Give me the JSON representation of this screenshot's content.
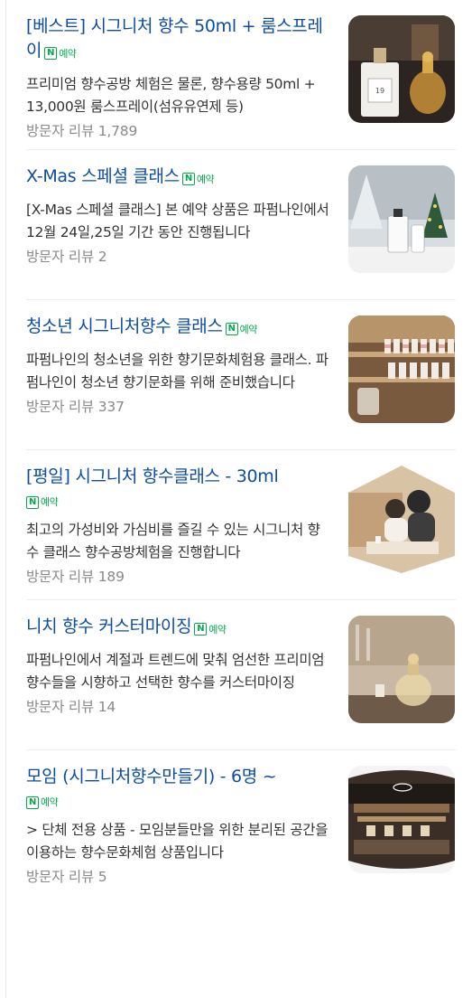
{
  "badge": {
    "icon": "N",
    "label": "예약"
  },
  "colors": {
    "title": "#0c4da2",
    "badge": "#03a94d",
    "desc": "#333333",
    "meta": "#8a8a8a"
  },
  "items": [
    {
      "title": "[베스트] 시그니처 향수 50ml + 룸스프레이",
      "desc": "프리미엄 향수공방 체험은 물론, 향수용량 50ml + 13,000원 룸스프레이(섬유유연제 등)",
      "reviews": "방문자 리뷰 1,789",
      "image": "perfume-bottles-on-shelf"
    },
    {
      "title": "X-Mas 스페셜 클래스",
      "desc": "[X-Mas 스페셜 클래스] 본 예약 상품은 파펌나인에서 12월 24일,25일 기간 동안 진행됩니다",
      "reviews": "방문자 리뷰 2",
      "image": "christmas-perfume-display"
    },
    {
      "title": "청소년 시그니처향수 클래스",
      "desc": "파펌나인의 청소년을 위한 향기문화체험용 클래스. 파펌나인이 청소년 향기문화를 위해 준비했습니다",
      "reviews": "방문자 리뷰 337",
      "image": "fragrance-bottle-rack"
    },
    {
      "title": "[평일] 시그니처 향수클래스 - 30ml",
      "desc": "최고의 가성비와 가심비를 즐길 수 있는 시그니처 향수 클래스 향수공방체험을 진행합니다",
      "reviews": "방문자 리뷰 189",
      "image": "people-making-perfume"
    },
    {
      "title": "니치 향수 커스터마이징",
      "desc": "파펌나인에서 계절과 트렌드에 맞춰 엄선한 프리미엄 향수들을 시향하고 선택한 향수를 커스터마이징",
      "reviews": "방문자 리뷰 14",
      "image": "glass-perfume-bottle"
    },
    {
      "title": "모임 (시그니처향수만들기) - 6명 ~",
      "desc": "> 단체 전용 상품 - 모임분들만을 위한 분리된 공간을 이용하는 향수문화체험 상품입니다",
      "reviews": "방문자 리뷰 5",
      "image": "workshop-room-interior"
    }
  ]
}
